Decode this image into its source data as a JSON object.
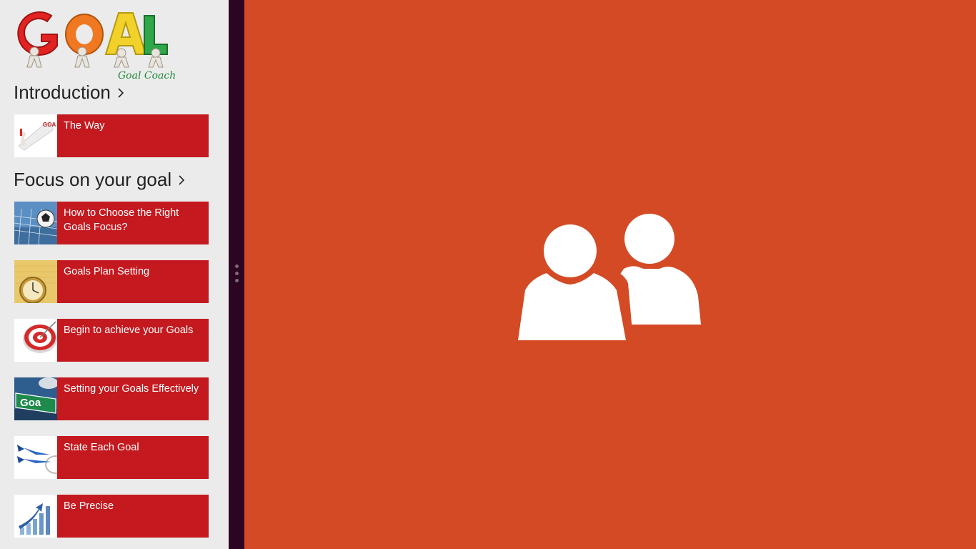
{
  "app": {
    "logo_text": "GOAL",
    "logo_caption": "Goal Coach"
  },
  "sections": [
    {
      "title": "Introduction",
      "items": [
        {
          "label": "The Way",
          "thumb": "goal-arrow-image"
        }
      ]
    },
    {
      "title": "Focus on your goal",
      "items": [
        {
          "label": "How to Choose the Right Goals Focus?",
          "thumb": "soccer-ball-image"
        },
        {
          "label": "Goals Plan Setting",
          "thumb": "stopwatch-image"
        },
        {
          "label": "Begin to achieve your Goals",
          "thumb": "target-image"
        },
        {
          "label": "Setting your Goals Effectively",
          "thumb": "goal-sign-image"
        },
        {
          "label": "State Each Goal",
          "thumb": "darts-image"
        },
        {
          "label": "Be Precise",
          "thumb": "growth-chart-image"
        }
      ]
    }
  ],
  "splash": {
    "icon": "people-icon"
  },
  "colors": {
    "accent_main": "#D34A25",
    "tile_red": "#C4191F",
    "pane_bg": "#EBEBEB",
    "splitter": "#2B0522"
  }
}
